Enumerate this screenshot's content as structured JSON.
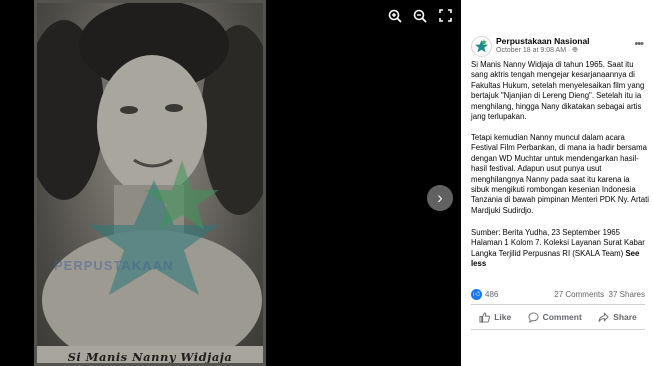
{
  "viewer": {
    "photo_caption": "Si Manis Nanny Widjaja",
    "watermark": "PERPUSTAKAAN",
    "tools": {
      "zoom_in": "zoom-in-icon",
      "zoom_out": "zoom-out-icon",
      "fullscreen": "fullscreen-icon"
    },
    "next_icon": "chevron-right-icon"
  },
  "post": {
    "page_name": "Perpustakaan Nasional",
    "time": "October 18 at 9:08 AM · ",
    "paragraphs": [
      "Si Manis Nanny Widjaja di tahun 1965. Saat itu sang aktris tengah mengejar kesarjanaannya di Fakultas Hukum, setelah menyelesaikan film yang bertajuk \"Njanjian di Lereng Dieng\". Setelah itu ia menghilang, hingga Nany dikatakan sebagai artis jang terlupakan.",
      "Tetapi kemudian Nanny muncul dalam acara Festival Film Perbankan, di mana ia hadir bersama dengan WD Muchtar untuk mendengarkan hasil-hasil festival. Adapun usut punya usut menghilangnya Nanny pada saat itu karena ia sibuk mengikuti rombongan kesenian Indonesia Tanzania di bawah pimpinan Menteri PDK Ny. Artati Mardjuki Sudirdjo.",
      "Sumber: Berita Yudha, 23 September 1965 Halaman 1 Kolom 7. Koleksi Layanan Surat Kabar Langka Terjilid Perpusnas RI (SKALA Team) "
    ],
    "see_less": "See less"
  },
  "stats": {
    "likes": "486",
    "comments": "27 Comments",
    "shares": "37 Shares"
  },
  "actions": {
    "like": "Like",
    "comment": "Comment",
    "share": "Share"
  },
  "colors": {
    "accent": "#1877f2",
    "muted": "#65676b",
    "viewer_bg": "#000000"
  }
}
